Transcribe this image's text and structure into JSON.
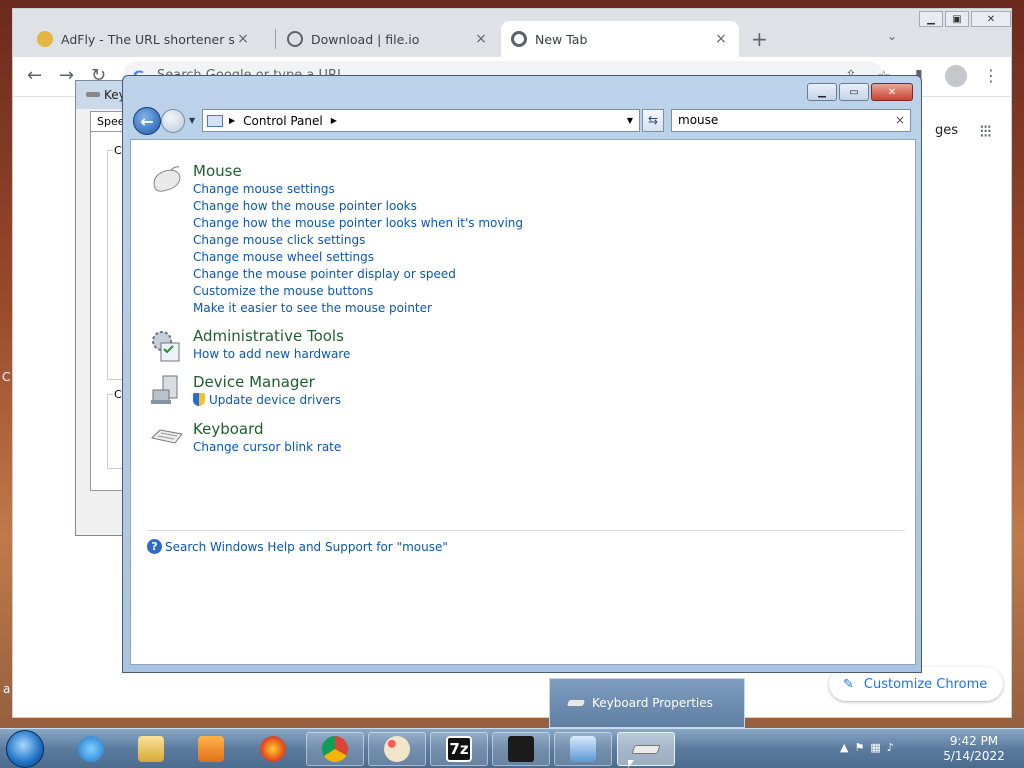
{
  "desktop": {
    "left_edge_glyphs": [
      "C",
      "a"
    ]
  },
  "chrome": {
    "tabs": [
      {
        "title": "AdFly - The URL shortener servic",
        "close": "×"
      },
      {
        "title": "Download | file.io",
        "close": "×"
      },
      {
        "title": "New Tab",
        "close": "×"
      }
    ],
    "new_tab": "+",
    "tab_search": "⌄",
    "omnibox_placeholder": "Search Google or type a URL",
    "ntp_images": "ges",
    "customize_label": "Customize Chrome"
  },
  "keyboard_dialog": {
    "title": "Key",
    "tab": "Spee",
    "group1_label": "Ch",
    "group2_label": "Cu"
  },
  "control_panel": {
    "breadcrumb": [
      "Control Panel"
    ],
    "search_value": "mouse",
    "groups": [
      {
        "icon": "mouse-icon",
        "title": "Mouse",
        "links": [
          "Change mouse settings",
          "Change how the mouse pointer looks",
          "Change how the mouse pointer looks when it's moving",
          "Change mouse click settings",
          "Change mouse wheel settings",
          "Change the mouse pointer display or speed",
          "Customize the mouse buttons",
          "Make it easier to see the mouse pointer"
        ]
      },
      {
        "icon": "admin-tools-icon",
        "title": "Administrative Tools",
        "links": [
          "How to add new hardware"
        ]
      },
      {
        "icon": "device-manager-icon",
        "title": "Device Manager",
        "links": [
          "Update device drivers"
        ]
      },
      {
        "icon": "keyboard-icon",
        "title": "Keyboard",
        "links": [
          "Change cursor blink rate"
        ]
      }
    ],
    "help_link": "Search Windows Help and Support for \"mouse\""
  },
  "taskbar": {
    "items": [
      "internet-explorer-icon",
      "file-explorer-icon",
      "media-player-icon",
      "firefox-icon",
      "chrome-icon",
      "paint-icon",
      "7zip-icon",
      "home-app-icon",
      "control-panel-icon",
      "keyboard-properties-icon"
    ],
    "seven_zip_label": "7z",
    "thumbnail_label": "Keyboard Properties",
    "clock_time": "9:42 PM",
    "clock_date": "5/14/2022"
  }
}
